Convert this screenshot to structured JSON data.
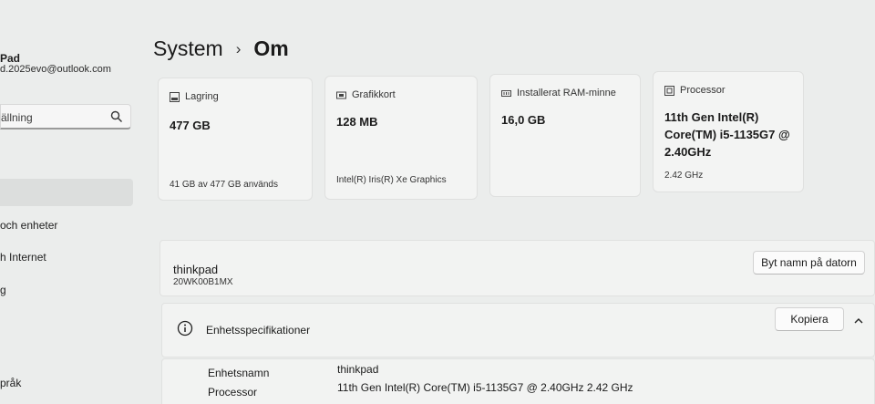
{
  "account": {
    "name": "Pad",
    "email": "d.2025evo@outlook.com"
  },
  "search": {
    "text": "ällning"
  },
  "nav": {
    "items": [
      {
        "label": "och enheter"
      },
      {
        "label": "h Internet"
      },
      {
        "label": "g"
      },
      {
        "label": "pråk"
      }
    ]
  },
  "breadcrumb": {
    "parent": "System",
    "separator": "›",
    "current": "Om"
  },
  "cards": [
    {
      "title": "Lagring",
      "value": "477 GB",
      "sub": "41 GB av 477 GB används",
      "icon": "storage-icon"
    },
    {
      "title": "Grafikkort",
      "value": "128 MB",
      "sub": "Intel(R) Iris(R) Xe Graphics",
      "icon": "graphics-card-icon"
    },
    {
      "title": "Installerat RAM-minne",
      "value": "16,0 GB",
      "sub": "",
      "icon": "ram-icon"
    },
    {
      "title": "Processor",
      "value": "11th Gen Intel(R) Core(TM) i5-1135G7 @ 2.40GHz",
      "sub": "2.42 GHz",
      "icon": "processor-icon"
    }
  ],
  "device": {
    "name": "thinkpad",
    "model": "20WK00B1MX",
    "rename_label": "Byt namn på datorn"
  },
  "specs": {
    "title": "Enhetsspecifikationer",
    "copy_label": "Kopiera",
    "rows": [
      {
        "label": "Enhetsnamn",
        "value": "thinkpad"
      },
      {
        "label": "Processor",
        "value": "11th Gen Intel(R) Core(TM) i5-1135G7 @ 2.40GHz   2.42 GHz"
      }
    ]
  }
}
